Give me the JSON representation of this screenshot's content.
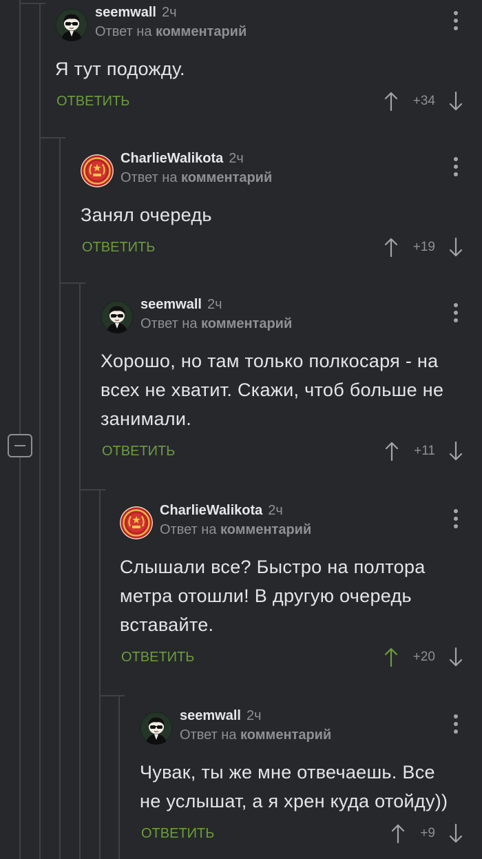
{
  "theme": {
    "background": "#26282c",
    "text": "#e4e5e7",
    "muted": "#8e9094",
    "accent_green": "#6c9d3b",
    "thread_line": "#3e4146",
    "icon": "#a3a5a8"
  },
  "icons": {
    "collapse": "minus-square-icon",
    "menu": "more-vertical-icon",
    "upvote": "arrow-up-icon",
    "downvote": "arrow-down-icon"
  },
  "comments": [
    {
      "author": "seemwall",
      "avatar": "seemwall-avatar",
      "time": "2ч",
      "reply_prefix": "Ответ на",
      "reply_target": "комментарий",
      "body_lines": [
        "Я тут подожду."
      ],
      "reply_label": "ОТВЕТИТЬ",
      "rating": "+34",
      "upvoted": false
    },
    {
      "author": "CharlieWalikota",
      "avatar": "charliewalikota-avatar",
      "time": "2ч",
      "reply_prefix": "Ответ на",
      "reply_target": "комментарий",
      "body_lines": [
        "Занял очередь"
      ],
      "reply_label": "ОТВЕТИТЬ",
      "rating": "+19",
      "upvoted": false
    },
    {
      "author": "seemwall",
      "avatar": "seemwall-avatar",
      "time": "2ч",
      "reply_prefix": "Ответ на",
      "reply_target": "комментарий",
      "body_lines": [
        "Хорошо, но там только полкосаря - на",
        "всех не хватит. Скажи, чтоб больше не",
        "занимали."
      ],
      "reply_label": "ОТВЕТИТЬ",
      "rating": "+11",
      "upvoted": false
    },
    {
      "author": "CharlieWalikota",
      "avatar": "charliewalikota-avatar",
      "time": "2ч",
      "reply_prefix": "Ответ на",
      "reply_target": "комментарий",
      "body_lines": [
        "Слышали все? Быстро на полтора",
        "метра отошли! В другую очередь",
        "вставайте."
      ],
      "reply_label": "ОТВЕТИТЬ",
      "rating": "+20",
      "upvoted": true
    },
    {
      "author": "seemwall",
      "avatar": "seemwall-avatar",
      "time": "2ч",
      "reply_prefix": "Ответ на",
      "reply_target": "комментарий",
      "body_lines": [
        "Чувак, ты же мне отвечаешь. Все",
        "не услышат, а я хрен куда отойду))"
      ],
      "reply_label": "ОТВЕТИТЬ",
      "rating": "+9",
      "upvoted": false
    }
  ]
}
